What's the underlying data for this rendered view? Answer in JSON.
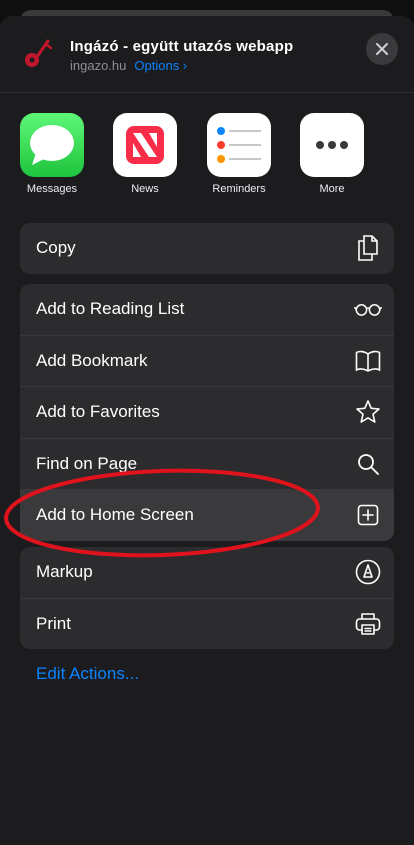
{
  "header": {
    "title": "Ingázó - együtt utazós webapp",
    "domain": "ingazo.hu",
    "options_label": "Options ›"
  },
  "apps": [
    {
      "label": "Messages",
      "icon": "messages-icon"
    },
    {
      "label": "News",
      "icon": "news-icon"
    },
    {
      "label": "Reminders",
      "icon": "reminders-icon"
    },
    {
      "label": "More",
      "icon": "more-icon"
    }
  ],
  "actions": {
    "copy": "Copy",
    "reading_list": "Add to Reading List",
    "bookmark": "Add Bookmark",
    "favorites": "Add to Favorites",
    "find": "Find on Page",
    "home_screen": "Add to Home Screen",
    "markup": "Markup",
    "print": "Print"
  },
  "edit_actions": "Edit Actions...",
  "colors": {
    "accent": "#0a84ff",
    "annotation": "#e0131d",
    "messages_green": "#34c759",
    "news_red": "#fa2d48"
  }
}
